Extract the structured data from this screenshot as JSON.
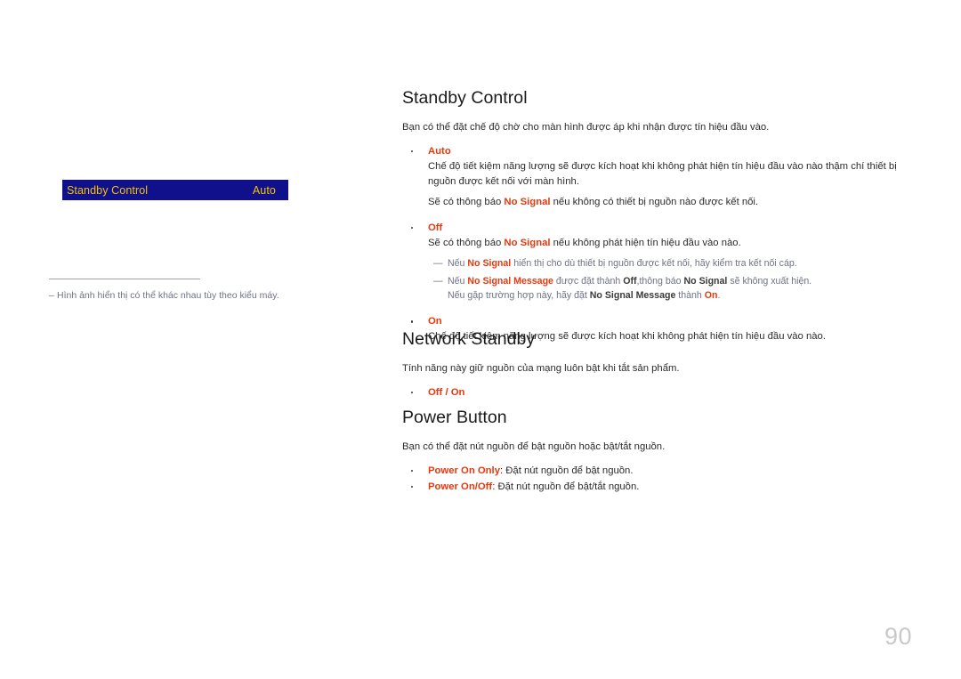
{
  "page": {
    "number": "90"
  },
  "left_panel": {
    "osd_menu": {
      "label": "Standby Control",
      "value": "Auto",
      "background_color": "#10108c",
      "text_color": "#f2c200"
    },
    "note": {
      "dash": "–",
      "text": "Hình ảnh hiển thị có thể khác nhau tùy theo kiểu máy."
    }
  },
  "sections": [
    {
      "id": "standby-control",
      "title": "Standby Control",
      "lead": "Bạn có thể đặt chế độ chờ cho màn hình được áp khi nhận được tín hiệu đầu vào.",
      "bullets": [
        {
          "head": "Auto",
          "body": "Chế độ tiết kiệm năng lượng sẽ được kích hoạt khi không phát hiện tín hiệu đầu vào nào thậm chí thiết bị nguồn được kết nối với màn hình.",
          "extra_pre": "Sẽ có thông báo ",
          "extra_kw": "No Signal",
          "extra_post": " nếu không có thiết bị nguồn nào được kết nối."
        },
        {
          "head": "Off",
          "body_pre": "Sẽ có thông báo ",
          "body_kw": "No Signal",
          "body_post": " nếu không phát hiện tín hiệu đầu vào nào."
        },
        {
          "head": "On",
          "body": "Chế độ tiết kiệm năng lượng sẽ được kích hoạt khi không phát hiện tín hiệu đầu vào nào."
        }
      ],
      "subnotes": [
        {
          "dash": "—",
          "p1": "Nếu ",
          "k1": "No Signal",
          "p2": " hiển thị cho dù thiết bị nguồn được kết nối, hãy kiểm tra kết nối cáp."
        },
        {
          "dash": "—",
          "p1": "Nếu ",
          "k1": "No Signal Message",
          "p2": " được đặt thành ",
          "k2": "Off",
          "p3": ",thông báo ",
          "k3": "No Signal",
          "p4": " sẽ không xuất hiện.",
          "cont_p1": "Nếu gặp trường hợp này, hãy đặt ",
          "cont_k1": "No Signal Message",
          "cont_p2": " thành ",
          "cont_k2": "On",
          "cont_p3": "."
        }
      ]
    },
    {
      "id": "network-standby",
      "title": "Network Standby",
      "lead": "Tính năng này giữ nguồn của mạng luôn bật khi tắt sản phẩm.",
      "bullets": [
        {
          "head": "Off / On"
        }
      ]
    },
    {
      "id": "power-button",
      "title": "Power Button",
      "lead": "Bạn có thể đặt nút nguồn để bật nguồn hoặc bật/tắt nguồn.",
      "bullets": [
        {
          "head": "Power On Only",
          "inline": ": Đặt nút nguồn để bật nguồn."
        },
        {
          "head": "Power On/Off",
          "inline": ": Đặt nút nguồn để bật/tắt nguồn."
        }
      ]
    }
  ],
  "colors": {
    "keyword_red": "#e8380d",
    "osd_blue": "#10108c",
    "osd_gold": "#f2c200",
    "note_gray": "#6f7286",
    "page_number_gray": "#c9c9c9"
  }
}
